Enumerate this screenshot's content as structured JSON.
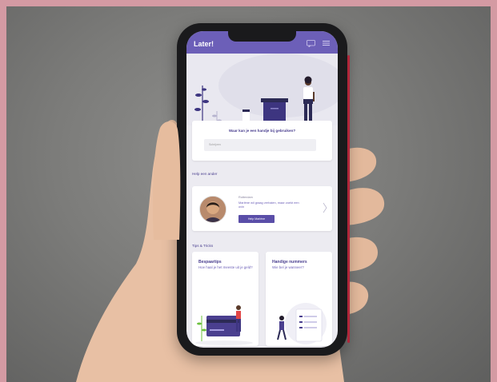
{
  "app": {
    "title": "Later!"
  },
  "icons": {
    "chat": "chat-icon",
    "menu": "menu-icon",
    "chevron": "chevron-right-icon"
  },
  "help": {
    "question": "Waar kan je een handje bij gebruiken?",
    "search_placeholder": "Schrijven"
  },
  "sections": {
    "help_someone": "Help een ander",
    "tips": "Tips & Tricks"
  },
  "person": {
    "location": "Rotterdam",
    "description": "Marlène wil graag verhalen, maar zoekt een ovin",
    "button": "Help Marlène"
  },
  "tips": [
    {
      "title": "Bespaartips",
      "subtitle": "Hoe haal je het meeste uit je geld?"
    },
    {
      "title": "Handige nummers",
      "subtitle": "Wie bel je wanneer?"
    }
  ],
  "colors": {
    "brand": "#6c5fb8",
    "brand_dark": "#4a3f8f",
    "frame": "#d49aa3"
  }
}
